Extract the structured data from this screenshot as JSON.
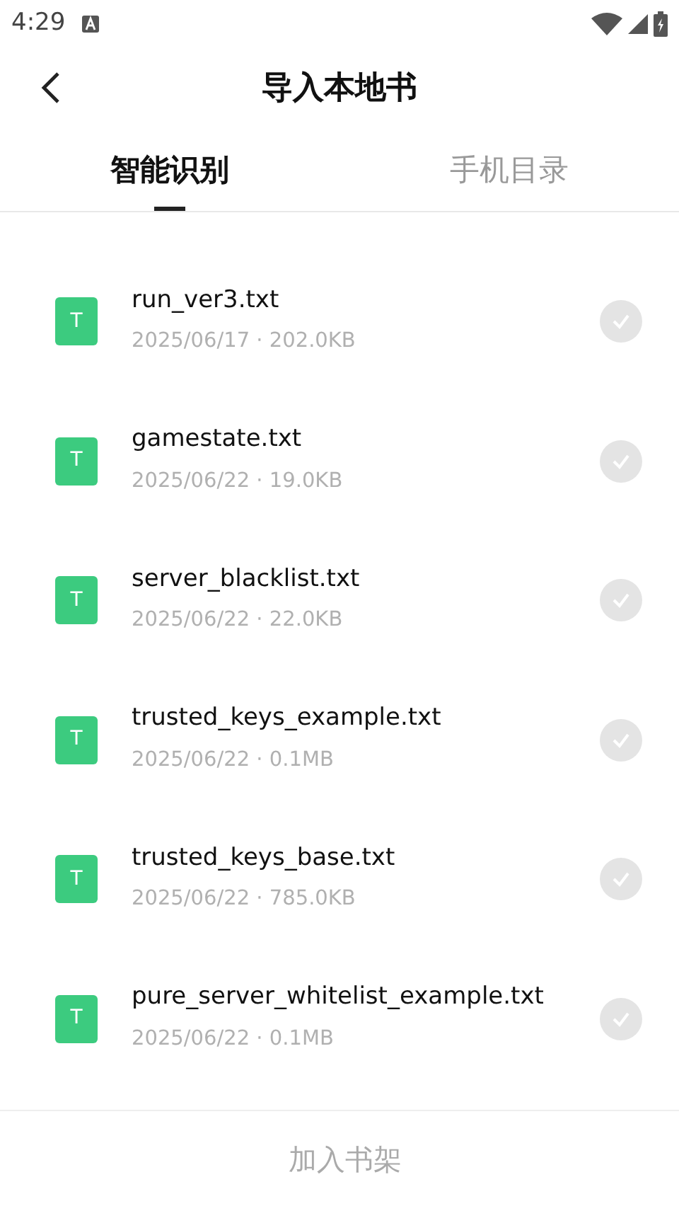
{
  "status_bar": {
    "time": "4:29"
  },
  "header": {
    "title": "导入本地书"
  },
  "tabs": [
    {
      "label": "智能识别",
      "selected": true
    },
    {
      "label": "手机目录",
      "selected": false
    }
  ],
  "files": [
    {
      "name": "run_ver3.txt",
      "meta": "2025/06/17 · 202.0KB",
      "icon_letter": "T",
      "checked": false
    },
    {
      "name": "gamestate.txt",
      "meta": "2025/06/22 · 19.0KB",
      "icon_letter": "T",
      "checked": false
    },
    {
      "name": "server_blacklist.txt",
      "meta": "2025/06/22 · 22.0KB",
      "icon_letter": "T",
      "checked": false
    },
    {
      "name": "trusted_keys_example.txt",
      "meta": "2025/06/22 · 0.1MB",
      "icon_letter": "T",
      "checked": false
    },
    {
      "name": "trusted_keys_base.txt",
      "meta": "2025/06/22 · 785.0KB",
      "icon_letter": "T",
      "checked": false
    },
    {
      "name": "pure_server_whitelist_example.txt",
      "meta": "2025/06/22 · 0.1MB",
      "icon_letter": "T",
      "checked": false
    }
  ],
  "bottom_bar": {
    "button": {
      "label": "加入书架",
      "disabled": true
    }
  }
}
